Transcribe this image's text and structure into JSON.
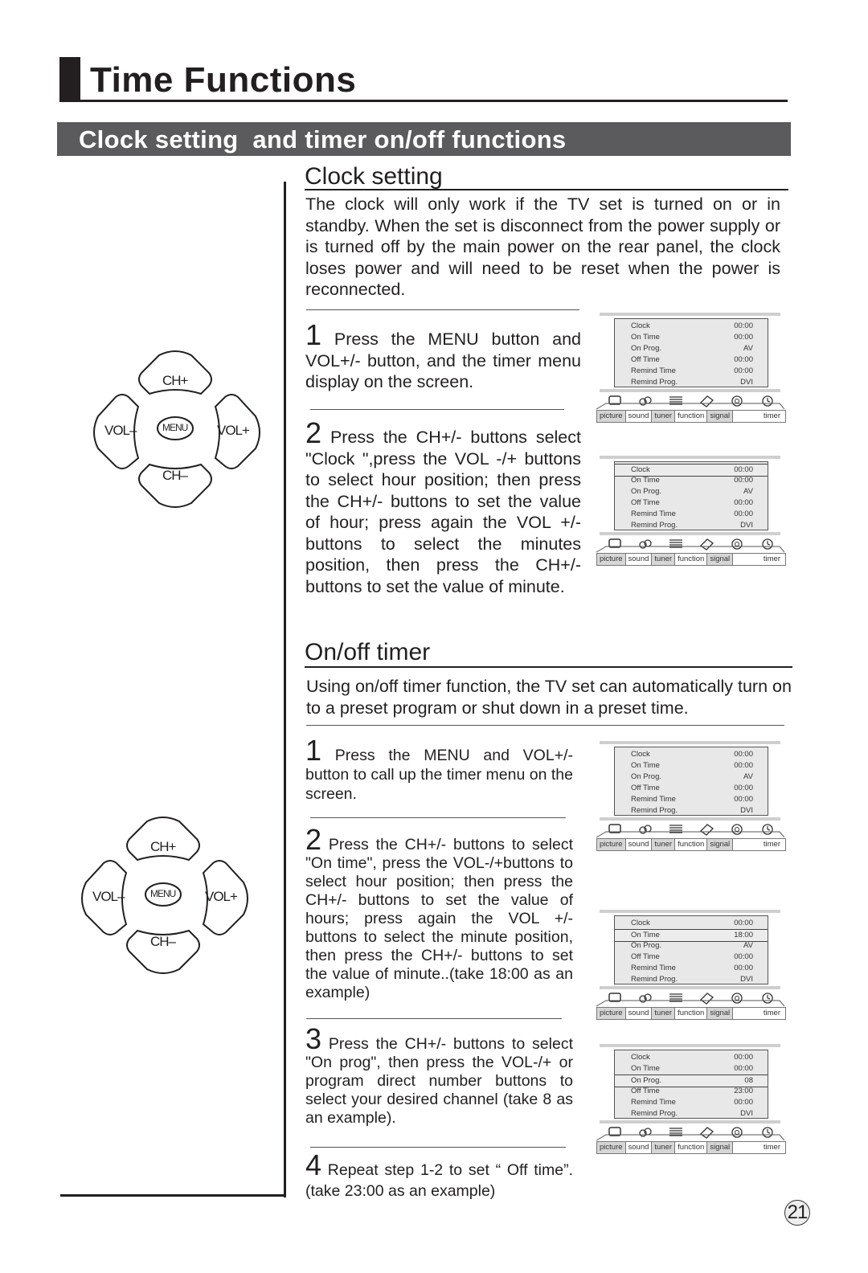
{
  "page": {
    "title": "Time Functions",
    "section_title": "Clock setting  and timer on/off functions",
    "page_number": "21"
  },
  "remote": {
    "ch_up": "CH+",
    "ch_down": "CH–",
    "vol_down": "VOL–",
    "vol_up": "VOL+",
    "menu": "MENU"
  },
  "clock_setting": {
    "heading": "Clock setting",
    "intro": "The clock will only work if the TV set is  turned on or in standby. When the set is disconnect from the power supply or is turned off by the main power on the rear panel, the clock loses power and will need to be reset when the power is reconnected.",
    "steps": [
      {
        "num": "1",
        "text": " Press the MENU button and VOL+/- button, and the timer menu display on the screen."
      },
      {
        "num": "2",
        "text": " Press the CH+/- buttons select \"Clock \",press the VOL -/+ buttons to select hour position; then press the CH+/- buttons to set the value of hour; press again the VOL +/- buttons to select the minutes position, then press the CH+/- buttons to set the value of minute."
      }
    ]
  },
  "onoff_timer": {
    "heading": "On/off timer",
    "intro": "Using on/off timer function, the TV set can automatically turn on to a preset program or shut down in a preset time.",
    "steps": [
      {
        "num": "1",
        "text": " Press the MENU and VOL+/- button to call up the timer  menu on the screen."
      },
      {
        "num": "2",
        "text": " Press the CH+/- buttons to select \"On time\", press the VOL-/+buttons to select hour position; then press the CH+/- buttons to set the value of hours; press again the VOL +/- buttons to select the minute position, then press the CH+/- buttons to set the value of minute..(take 18:00 as an example)"
      },
      {
        "num": "3",
        "text": " Press the CH+/- buttons to select \"On prog\", then press the VOL-/+ or program direct number buttons to select your desired channel (take 8 as an example)."
      },
      {
        "num": "4",
        "text": " Repeat step 1-2 to set “ Off time”.(take 23:00 as an example)"
      }
    ]
  },
  "menu_tabs": [
    "picture",
    "sound",
    "tuner",
    "function",
    "signal",
    "timer"
  ],
  "menu_tab_icons": [
    "picture-icon",
    "sound-icon",
    "tuner-icon",
    "function-icon",
    "signal-icon",
    "timer-icon"
  ],
  "menus": [
    {
      "highlight": -1,
      "rows": [
        [
          "Clock",
          "00:00"
        ],
        [
          "On Time",
          "00:00"
        ],
        [
          "On Prog.",
          "AV"
        ],
        [
          "Off Time",
          "00:00"
        ],
        [
          "Remind Time",
          "00:00"
        ],
        [
          "Remind Prog.",
          "DVI"
        ]
      ]
    },
    {
      "highlight": 0,
      "rows": [
        [
          "Clock",
          "00:00"
        ],
        [
          "On Time",
          "00:00"
        ],
        [
          "On Prog.",
          "AV"
        ],
        [
          "Off Time",
          "00:00"
        ],
        [
          "Remind Time",
          "00:00"
        ],
        [
          "Remind Prog.",
          "DVI"
        ]
      ]
    },
    {
      "highlight": -1,
      "rows": [
        [
          "Clock",
          "00:00"
        ],
        [
          "On Time",
          "00:00"
        ],
        [
          "On Prog.",
          "AV"
        ],
        [
          "Off Time",
          "00:00"
        ],
        [
          "Remind Time",
          "00:00"
        ],
        [
          "Remind Prog.",
          "DVI"
        ]
      ]
    },
    {
      "highlight": 1,
      "rows": [
        [
          "Clock",
          "00:00"
        ],
        [
          "On Time",
          "18:00"
        ],
        [
          "On Prog.",
          "AV"
        ],
        [
          "Off Time",
          "00:00"
        ],
        [
          "Remind Time",
          "00:00"
        ],
        [
          "Remind Prog.",
          "DVI"
        ]
      ]
    },
    {
      "highlight": 2,
      "rows": [
        [
          "Clock",
          "00:00"
        ],
        [
          "On Time",
          "00:00"
        ],
        [
          "On Prog.",
          "08"
        ],
        [
          "Off Time",
          "23:00"
        ],
        [
          "Remind Time",
          "00:00"
        ],
        [
          "Remind Prog.",
          "DVI"
        ]
      ]
    }
  ]
}
